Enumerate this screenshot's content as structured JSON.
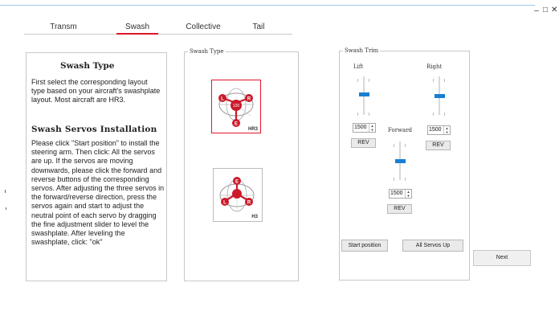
{
  "window": {
    "minimize": "–",
    "maximize": "□",
    "close": "✕"
  },
  "tabs": [
    {
      "label": "Transm"
    },
    {
      "label": "Swash"
    },
    {
      "label": "Collective"
    },
    {
      "label": "Tail"
    }
  ],
  "active_tab": "Swash",
  "info": {
    "title": "Swash Type",
    "body": "First select the corresponding layout type based on your aircraft's swashplate layout. Most aircraft are HR3.",
    "servos_title": "Swash Servos Installation",
    "servos_body": "Please click \"Start position\" to install the steering arm. Then click: All the servos are up. If the servos are moving downwards, please click the forward and reverse buttons of the corresponding servos. After adjusting the three servos in the forward/reverse direction, press the servos again and start to adjust the neutral point of each servo by dragging the fine adjustment slider to level the swashplate. After leveling the swashplate, click: \"ok\""
  },
  "swash_type": {
    "legend": "Swash Type",
    "options": [
      {
        "name": "HR3",
        "selected": true,
        "labels": [
          "L",
          "120",
          "R",
          "E"
        ]
      },
      {
        "name": "H3",
        "selected": false,
        "labels": [
          "E",
          "L",
          "R"
        ]
      }
    ]
  },
  "swash_trim": {
    "legend": "Swash Trim",
    "lift": {
      "label": "Lift",
      "value": "1500",
      "rev": "REV"
    },
    "right": {
      "label": "Right",
      "value": "1500",
      "rev": "REV"
    },
    "forward": {
      "label": "Forward",
      "value": "1500",
      "rev": "REV"
    },
    "start_position": "Start position",
    "all_servos_up": "All Servos Up"
  },
  "next_button": "Next",
  "colors": {
    "accent": "#e0162b",
    "slider": "#1a7fd4",
    "border": "#c8c8c8"
  }
}
